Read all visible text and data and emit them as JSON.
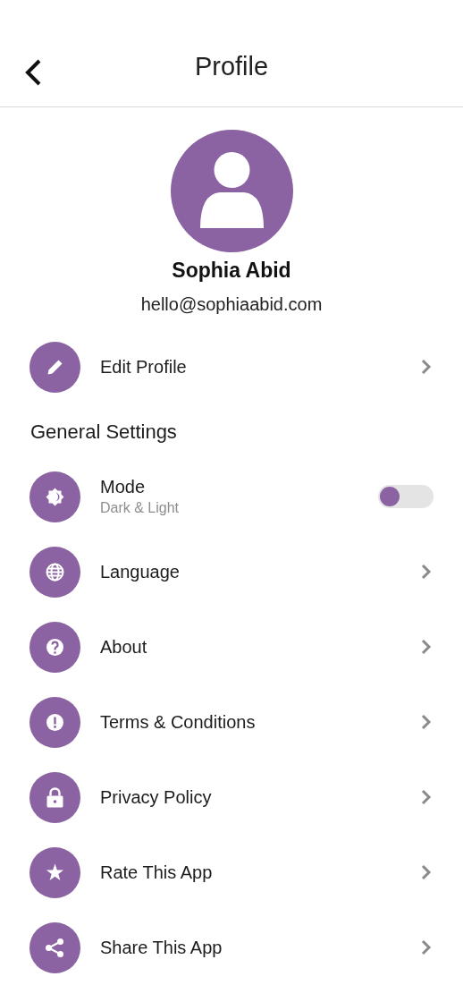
{
  "header": {
    "title": "Profile"
  },
  "profile": {
    "name": "Sophia Abid",
    "email": "hello@sophiaabid.com"
  },
  "account_items": [
    {
      "kind": "link",
      "label": "Edit Profile"
    }
  ],
  "general_settings": {
    "title": "General Settings",
    "items": [
      {
        "kind": "toggle",
        "label": "Mode",
        "sublabel": "Dark & Light",
        "on": false
      },
      {
        "kind": "link",
        "label": "Language"
      },
      {
        "kind": "link",
        "label": "About"
      },
      {
        "kind": "link",
        "label": "Terms & Conditions"
      },
      {
        "kind": "link",
        "label": "Privacy Policy"
      },
      {
        "kind": "link",
        "label": "Rate This App"
      },
      {
        "kind": "link",
        "label": "Share This App"
      }
    ]
  }
}
